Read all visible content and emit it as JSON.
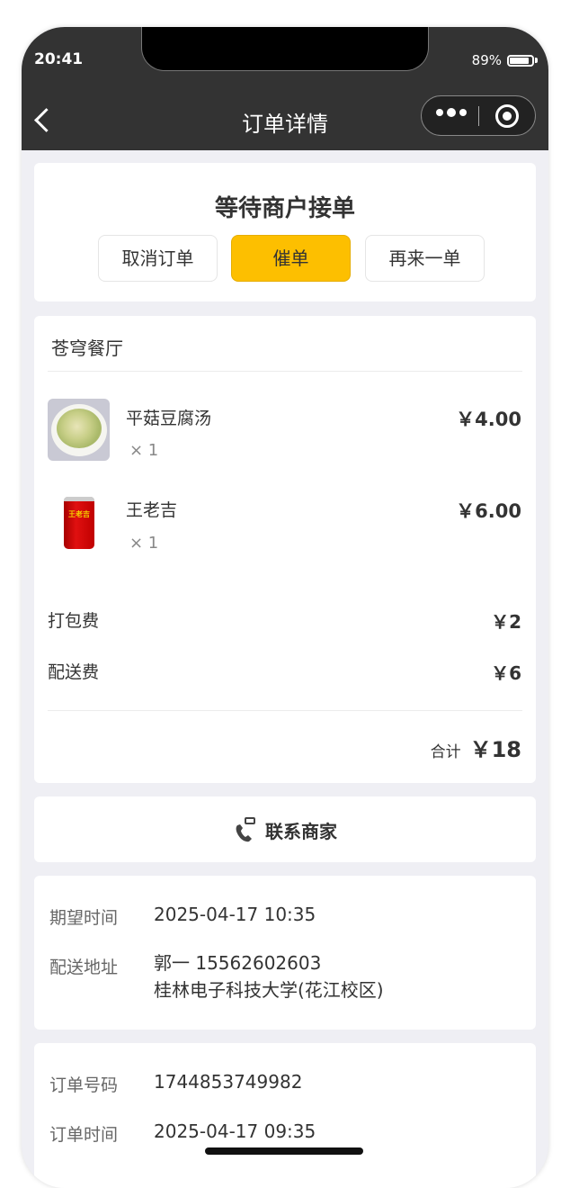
{
  "status_bar": {
    "time": "20:41",
    "battery_percent_label": "89%",
    "battery_level": 0.89
  },
  "nav": {
    "title": "订单详情"
  },
  "status": {
    "title": "等待商户接单",
    "buttons": {
      "cancel": "取消订单",
      "urge": "催单",
      "reorder": "再来一单"
    }
  },
  "order": {
    "shop_name": "苍穹餐厅",
    "items": [
      {
        "name": "平菇豆腐汤",
        "qty": "× 1",
        "price": "￥4.00"
      },
      {
        "name": "王老吉",
        "qty": "× 1",
        "price": "￥6.00",
        "can_label": "王老吉"
      }
    ],
    "fees": [
      {
        "label": "打包费",
        "value": "￥2"
      },
      {
        "label": "配送费",
        "value": "￥6"
      }
    ],
    "total_label": "合计",
    "total_value": "￥18"
  },
  "contact": {
    "label": "联系商家"
  },
  "delivery": {
    "expected_time_label": "期望时间",
    "expected_time": "2025-04-17 10:35",
    "address_label": "配送地址",
    "address_line1": "郭一 15562602603",
    "address_line2": "桂林电子科技大学(花江校区)"
  },
  "order_info": {
    "order_no_label": "订单号码",
    "order_no": "1744853749982",
    "order_time_label": "订单时间",
    "order_time": "2025-04-17 09:35"
  },
  "colors": {
    "header_bg": "#333333",
    "accent": "#fdbf00",
    "page_bg": "#efeff4"
  }
}
